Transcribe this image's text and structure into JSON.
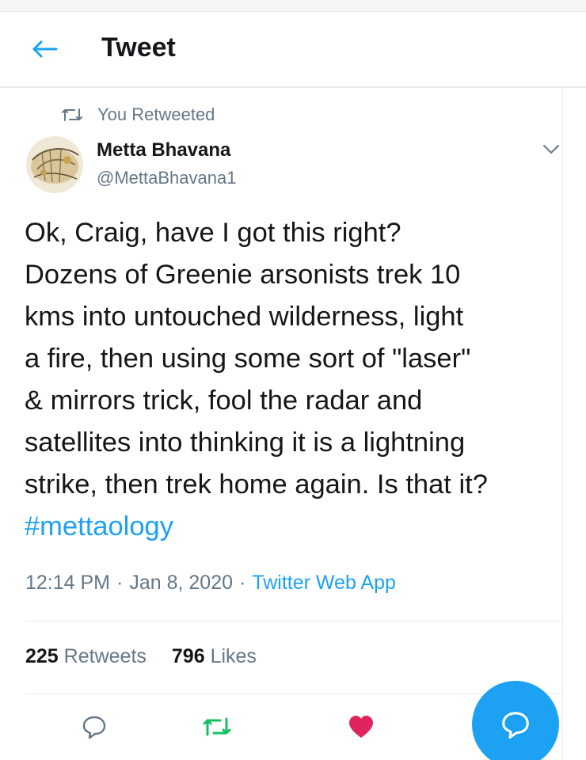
{
  "header": {
    "title": "Tweet",
    "back_icon": "arrow-left-icon"
  },
  "social_context": {
    "icon": "retweet-icon",
    "text": "You Retweeted"
  },
  "author": {
    "name": "Metta Bhavana",
    "handle": "@MettaBhavana1",
    "avatar": "avatar-image",
    "menu_icon": "chevron-down-icon"
  },
  "tweet": {
    "text": "Ok, Craig, have I got this right?\nDozens of Greenie arsonists trek 10\nkms into untouched wilderness, light\na fire, then using some sort of \"laser\"\n& mirrors trick, fool the radar and\nsatellites into thinking it is a lightning\nstrike, then trek home again. Is that it?\n",
    "hashtag": "#mettaology",
    "time": "12:14 PM",
    "separator": "·",
    "date": "Jan 8, 2020",
    "source": "Twitter Web App"
  },
  "stats": {
    "retweets_count": "225",
    "retweets_label": "Retweets",
    "likes_count": "796",
    "likes_label": "Likes"
  },
  "actions": {
    "reply_icon": "reply-icon",
    "retweet_icon": "retweet-icon",
    "like_icon": "heart-icon",
    "compose_icon": "compose-reply-icon"
  },
  "colors": {
    "accent": "#1da1f2",
    "retweet_active": "#17bf63",
    "like_active": "#e0245e",
    "secondary_text": "#657786"
  }
}
